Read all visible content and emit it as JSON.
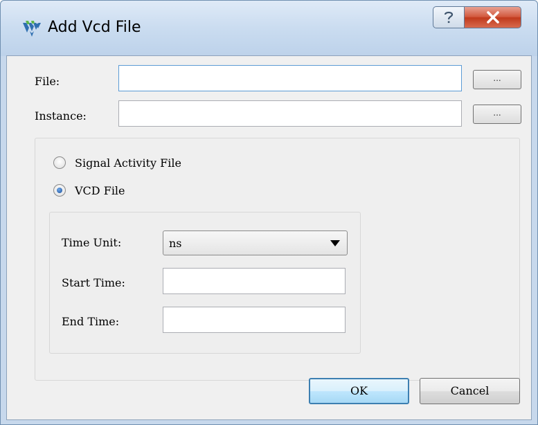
{
  "window": {
    "title": "Add Vcd File",
    "help_glyph": "?",
    "close_glyph": "X"
  },
  "fields": {
    "file_label": "File:",
    "file_value": "",
    "instance_label": "Instance:",
    "instance_value": "",
    "browse_label": "..."
  },
  "options": {
    "signal_activity_label": "Signal Activity File",
    "vcd_file_label": "VCD File",
    "selected": "VCD File"
  },
  "vcd": {
    "time_unit_label": "Time Unit:",
    "time_unit_value": "ns",
    "start_time_label": "Start Time:",
    "start_time_value": "",
    "end_time_label": "End Time:",
    "end_time_value": ""
  },
  "buttons": {
    "ok": "OK",
    "cancel": "Cancel"
  },
  "colors": {
    "accent": "#3c7fb1",
    "close": "#c03a1c",
    "icon": "#2f6fb0"
  },
  "icons": {
    "app": "vcd-app-icon",
    "help": "help-icon",
    "close": "close-icon",
    "dropdown": "chevron-down-icon"
  }
}
